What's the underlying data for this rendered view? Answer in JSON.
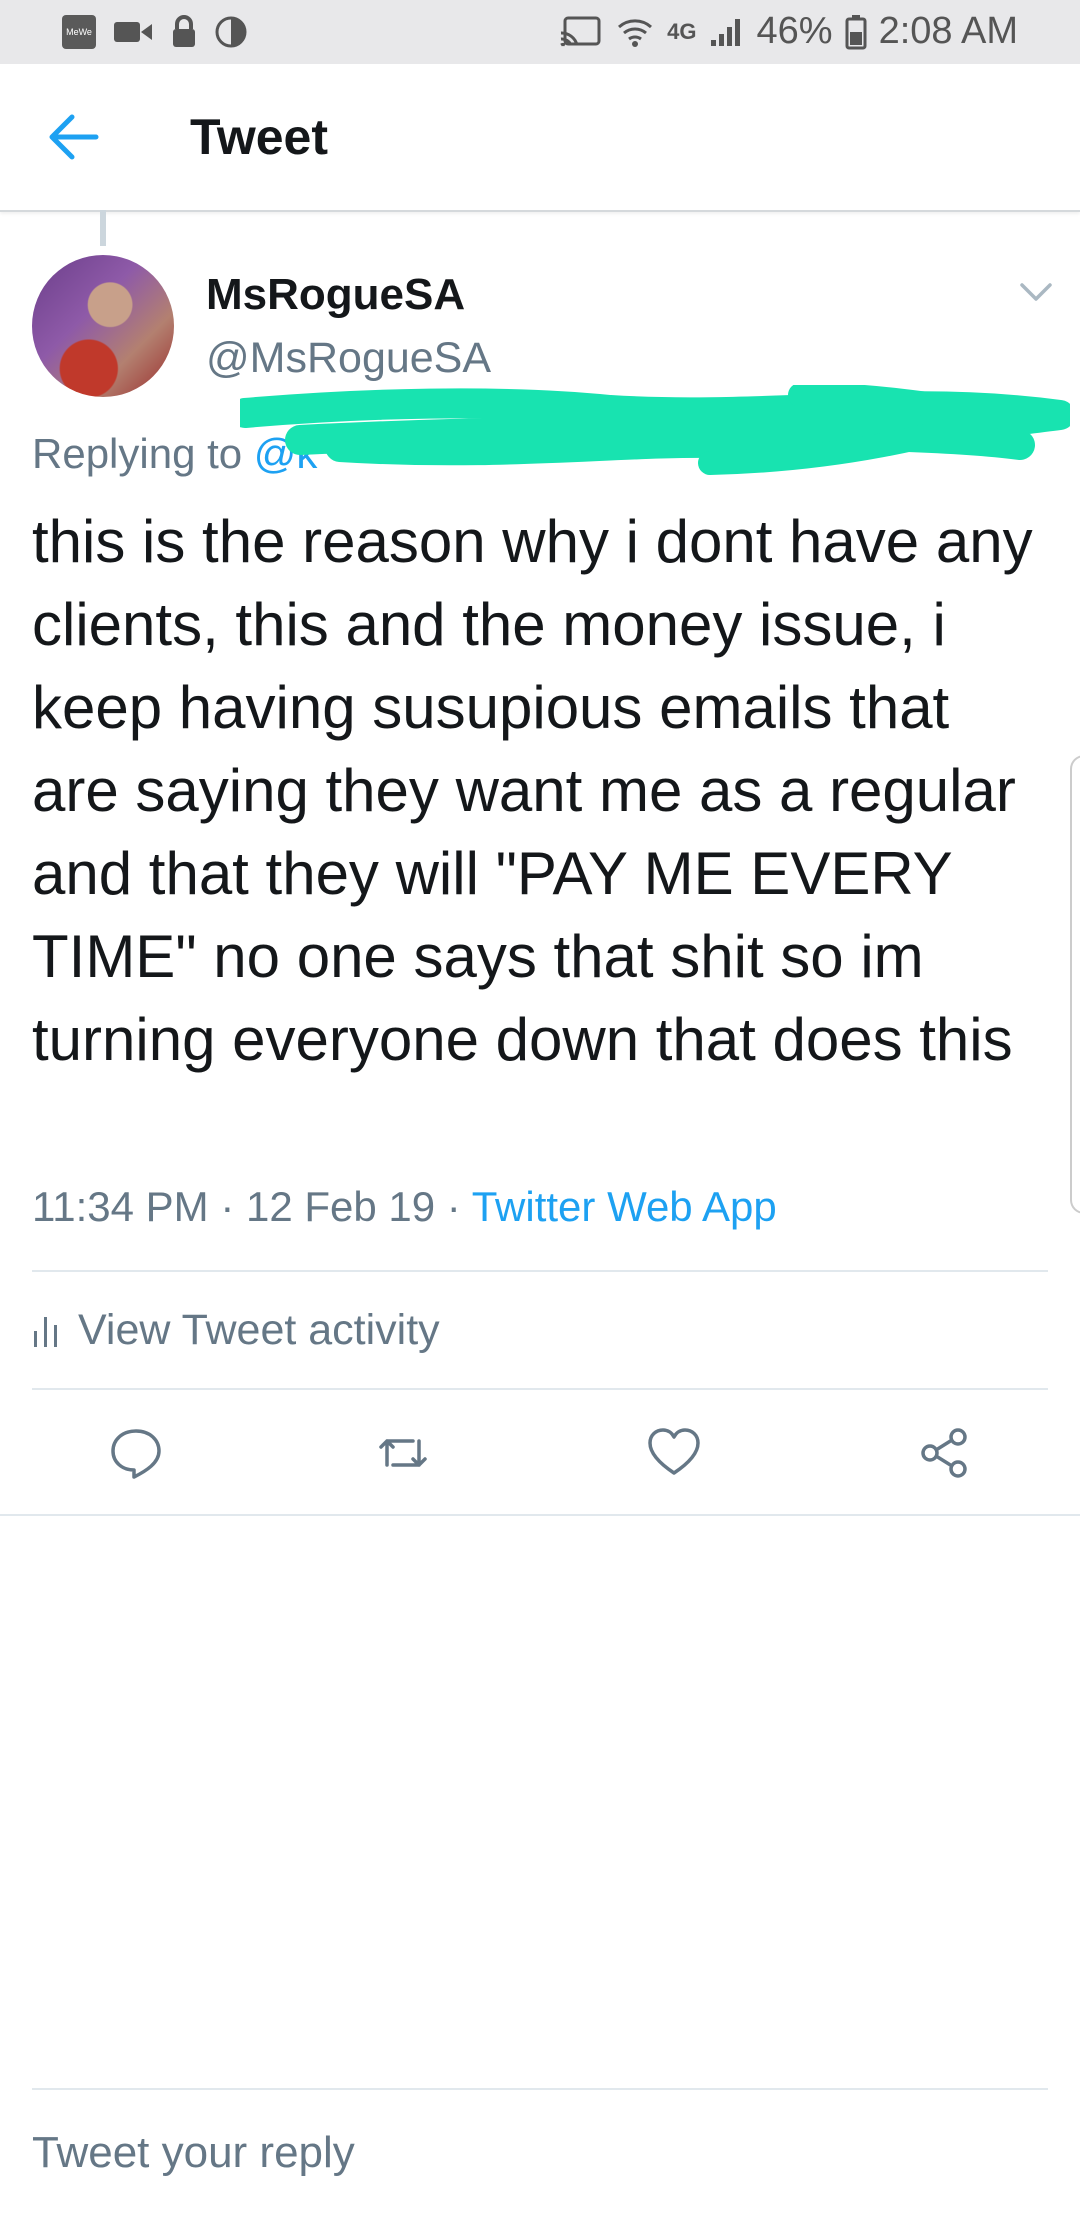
{
  "status_bar": {
    "app_icon_label": "MeWe",
    "network": "4G",
    "battery": "46%",
    "time": "2:08 AM"
  },
  "header": {
    "title": "Tweet"
  },
  "tweet": {
    "display_name": "MsRogueSA",
    "handle": "@MsRogueSA",
    "replying_prefix": "Replying to ",
    "replying_visible": "@k",
    "text": "this is the reason why i dont have any clients, this and the money issue, i keep having susupious emails that are saying they want me as a regular and that they will \"PAY ME EVERY TIME\" no one says that shit so im turning everyone down that does this",
    "time": "11:34 PM",
    "separator": " · ",
    "date": "12 Feb 19",
    "source": "Twitter Web App",
    "redaction_color": "#18e3b0"
  },
  "activity": {
    "label": "View Tweet activity"
  },
  "actions": {
    "icons": [
      "reply-icon",
      "retweet-icon",
      "like-icon",
      "share-icon"
    ]
  },
  "reply_box": {
    "placeholder": "Tweet your reply"
  },
  "colors": {
    "accent": "#1da1f2",
    "secondary_text": "#657786",
    "primary_text": "#14171a"
  }
}
